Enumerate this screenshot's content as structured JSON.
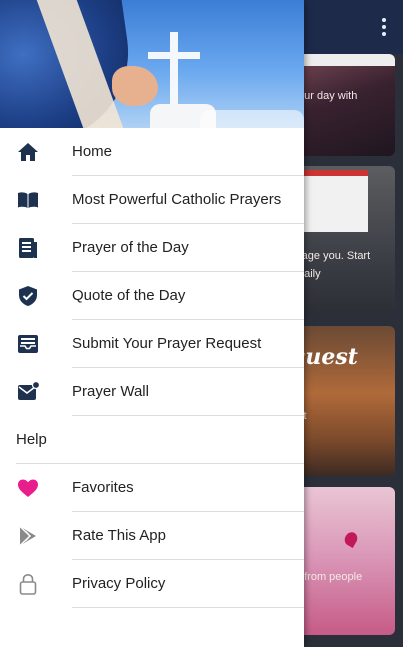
{
  "background": {
    "cards": [
      {
        "text": "our day with"
      },
      {
        "text": "rage you. Start",
        "text2": "daily"
      },
      {
        "title": "quest",
        "text": "st"
      },
      {
        "text": "t from people"
      }
    ]
  },
  "drawer": {
    "items": [
      {
        "label": "Home",
        "icon": "home-icon"
      },
      {
        "label": "Most Powerful Catholic Prayers",
        "icon": "book-icon"
      },
      {
        "label": "Prayer of the Day",
        "icon": "article-icon"
      },
      {
        "label": "Quote of the Day",
        "icon": "shield-check-icon"
      },
      {
        "label": "Submit Your Prayer Request",
        "icon": "inbox-icon"
      },
      {
        "label": "Prayer Wall",
        "icon": "mail-badge-icon"
      }
    ],
    "section_header": "Help",
    "help_items": [
      {
        "label": "Favorites",
        "icon": "heart-icon"
      },
      {
        "label": "Rate This App",
        "icon": "play-store-icon"
      },
      {
        "label": "Privacy Policy",
        "icon": "lock-icon"
      }
    ]
  },
  "colors": {
    "icon_dark": "#1e3250",
    "heart": "#e91e8c",
    "app_bar": "#1d2a4a"
  }
}
